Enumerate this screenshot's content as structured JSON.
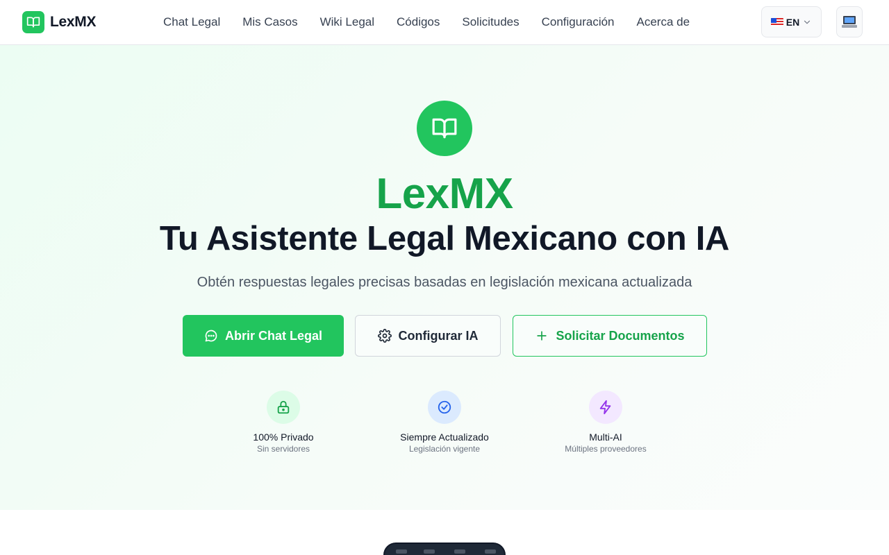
{
  "header": {
    "brand": "LexMX",
    "nav": [
      "Chat Legal",
      "Mis Casos",
      "Wiki Legal",
      "Códigos",
      "Solicitudes",
      "Configuración",
      "Acerca de"
    ],
    "language": "EN"
  },
  "hero": {
    "title": "LexMX",
    "subtitle": "Tu Asistente Legal Mexicano con IA",
    "description": "Obtén respuestas legales precisas basadas en legislación mexicana actualizada",
    "buttons": {
      "chat": "Abrir Chat Legal",
      "config": "Configurar IA",
      "docs": "Solicitar Documentos"
    },
    "features": [
      {
        "title": "100% Privado",
        "subtitle": "Sin servidores",
        "icon": "lock-icon",
        "color": "#16a34a"
      },
      {
        "title": "Siempre Actualizado",
        "subtitle": "Legislación vigente",
        "icon": "check-circle-icon",
        "color": "#2563eb"
      },
      {
        "title": "Multi-AI",
        "subtitle": "Múltiples proveedores",
        "icon": "lightning-icon",
        "color": "#9333ea"
      }
    ]
  },
  "colors": {
    "accent": "#22c55e",
    "accent_dark": "#16a34a",
    "text": "#111827"
  }
}
